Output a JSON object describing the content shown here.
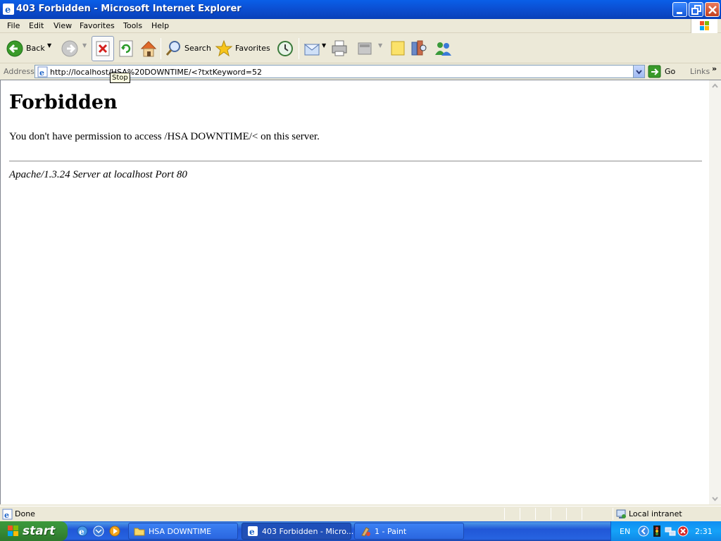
{
  "window": {
    "title": "403 Forbidden - Microsoft Internet Explorer"
  },
  "menu": {
    "items": [
      "File",
      "Edit",
      "View",
      "Favorites",
      "Tools",
      "Help"
    ]
  },
  "toolbar": {
    "back_label": "Back",
    "search_label": "Search",
    "favorites_label": "Favorites",
    "stop_tooltip": "Stop"
  },
  "address": {
    "label": "Address",
    "url": "http://localhost/HSA%20DOWNTIME/<?txtKeyword=52",
    "go_label": "Go",
    "links_label": "Links"
  },
  "page": {
    "heading": "Forbidden",
    "message": "You don't have permission to access /HSA DOWNTIME/< on this server.",
    "footer": "Apache/1.3.24 Server at localhost Port 80"
  },
  "status": {
    "text": "Done",
    "zone": "Local intranet"
  },
  "taskbar": {
    "start_label": "start",
    "tasks": [
      "HSA DOWNTIME",
      "403 Forbidden - Micro...",
      "1 - Paint"
    ],
    "language": "EN",
    "clock": "2:31"
  },
  "colors": {
    "titlebar": "#0b4fd3",
    "taskbar": "#2157d7",
    "start": "#388e37",
    "tray": "#15a2f8"
  }
}
